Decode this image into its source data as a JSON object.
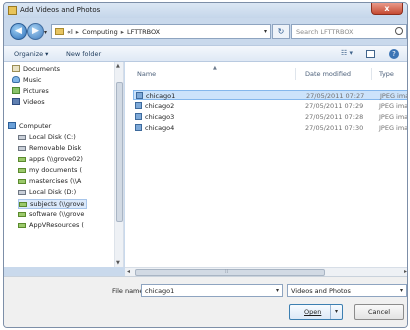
{
  "window": {
    "title": "Add Videos and Photos",
    "close_glyph": "x"
  },
  "nav": {
    "back_glyph": "◀",
    "forward_glyph": "▶",
    "recent_glyph": "▾",
    "breadcrumb": [
      "«l",
      "Computing",
      "LFTTRBOX"
    ],
    "address_dropdown_glyph": "▾",
    "refresh_glyph": "↻",
    "search_placeholder": "Search LFTTRBOX"
  },
  "toolbar": {
    "organize": "Organize ▾",
    "new_folder": "New folder",
    "views_glyph": "☷ ▾"
  },
  "sidebar": {
    "favorites": [
      "Documents",
      "Music",
      "Pictures",
      "Videos"
    ],
    "computer_label": "Computer",
    "drives": [
      "Local Disk (C:)",
      "Removable Disk",
      "apps (\\\\grove02)",
      "my documents (",
      "mastercises (\\\\A",
      "Local Disk (D:)",
      "subjects (\\\\grove",
      "software (\\\\grove",
      "AppVResources ("
    ],
    "selected_drive_index": 6
  },
  "columns": {
    "name": "Name",
    "date": "Date modified",
    "type": "Type"
  },
  "files": [
    {
      "name": "chicago1",
      "date": "27/05/2011 07:27",
      "type": "JPEG image"
    },
    {
      "name": "chicago2",
      "date": "27/05/2011 07:29",
      "type": "JPEG image"
    },
    {
      "name": "chicago3",
      "date": "27/05/2011 07:28",
      "type": "JPEG image"
    },
    {
      "name": "chicago4",
      "date": "27/05/2011 07:30",
      "type": "JPEG image"
    }
  ],
  "selected_file_index": 0,
  "footer": {
    "filename_label": "File name:",
    "filename_value": "chicago1",
    "filetype_value": "Videos and Photos",
    "open_label": "Open",
    "cancel_label": "Cancel",
    "dropdown_glyph": "▾"
  }
}
